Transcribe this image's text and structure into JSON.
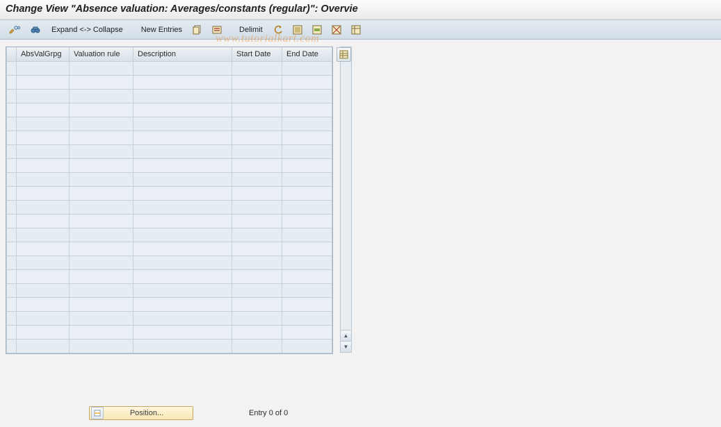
{
  "title": "Change View \"Absence valuation: Averages/constants (regular)\": Overvie",
  "toolbar": {
    "expand_collapse": "Expand <-> Collapse",
    "new_entries": "New Entries",
    "delimit": "Delimit"
  },
  "table": {
    "headers": {
      "absvalgrpg": "AbsValGrpg",
      "valuation_rule": "Valuation rule",
      "description": "Description",
      "start_date": "Start Date",
      "end_date": "End Date"
    },
    "row_count": 21,
    "rows": []
  },
  "footer": {
    "position_label": "Position...",
    "entry_text": "Entry 0 of 0"
  },
  "watermark": "www.tutorialkart.com"
}
